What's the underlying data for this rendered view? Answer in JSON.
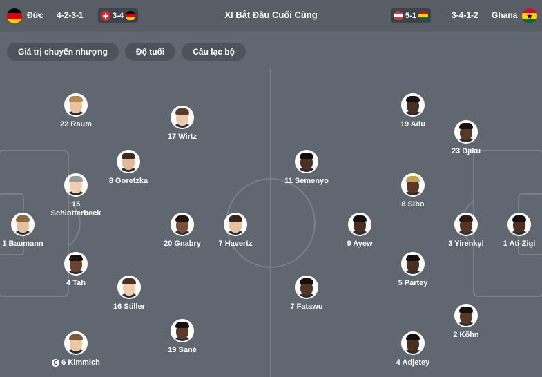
{
  "header": {
    "home": {
      "name": "Đức",
      "formation": "4-2-3-1"
    },
    "away": {
      "name": "Ghana",
      "formation": "3-4-1-2"
    },
    "title": "XI Bắt Đầu Cuối Cùng",
    "home_prev_score": "3-4",
    "away_prev_score": "5-1"
  },
  "tabs": [
    "Giá trị chuyển nhượng",
    "Độ tuổi",
    "Câu lạc bộ"
  ],
  "colors": {
    "header_bg": "#585d66",
    "pitch_bg": "#616770",
    "pitch_lines": "#7a7f88"
  },
  "home_players": [
    {
      "number": "22",
      "name": "Raum",
      "skin": "#e8c2a0",
      "hair": "#b08850"
    },
    {
      "number": "17",
      "name": "Wirtz",
      "skin": "#eec8a8",
      "hair": "#5a3a28"
    },
    {
      "number": "8",
      "name": "Goretzka",
      "skin": "#e2b896",
      "hair": "#3a2a20"
    },
    {
      "number": "15",
      "name": "Schlotterbeck",
      "skin": "#f0cdb0",
      "hair": "#9a9a9a"
    },
    {
      "number": "1",
      "name": "Baumann",
      "skin": "#e6bf9c",
      "hair": "#8a6a40"
    },
    {
      "number": "20",
      "name": "Gnabry",
      "skin": "#7a5038",
      "hair": "#1e1612"
    },
    {
      "number": "7",
      "name": "Havertz",
      "skin": "#e8c2a0",
      "hair": "#3a2618"
    },
    {
      "number": "4",
      "name": "Tah",
      "skin": "#6a4430",
      "hair": "#1a1210"
    },
    {
      "number": "16",
      "name": "Stiller",
      "skin": "#f0ccac",
      "hair": "#4a3222"
    },
    {
      "number": "19",
      "name": "Sané",
      "skin": "#5c3a28",
      "hair": "#151010"
    },
    {
      "number": "6",
      "name": "Kimmich",
      "skin": "#ecc6a4",
      "hair": "#7a5a3a",
      "captain": true
    }
  ],
  "away_players": [
    {
      "number": "19",
      "name": "Adu",
      "skin": "#4a2e20",
      "hair": "#141010"
    },
    {
      "number": "23",
      "name": "Djiku",
      "skin": "#5a3826",
      "hair": "#151010"
    },
    {
      "number": "11",
      "name": "Semenyo",
      "skin": "#4e3022",
      "hair": "#141010"
    },
    {
      "number": "8",
      "name": "Sibo",
      "skin": "#5a3826",
      "hair": "#c8a050"
    },
    {
      "number": "9",
      "name": "Ayew",
      "skin": "#4a2e20",
      "hair": "#141010"
    },
    {
      "number": "3",
      "name": "Yirenkyi",
      "skin": "#553522",
      "hair": "#2a1a10"
    },
    {
      "number": "1",
      "name": "Ati-Zigi",
      "skin": "#4e3022",
      "hair": "#141010"
    },
    {
      "number": "5",
      "name": "Partey",
      "skin": "#4a2e20",
      "hair": "#141010"
    },
    {
      "number": "7",
      "name": "Fatawu",
      "skin": "#553522",
      "hair": "#141010"
    },
    {
      "number": "2",
      "name": "Kõhn",
      "skin": "#5a3826",
      "hair": "#141010"
    },
    {
      "number": "4",
      "name": "Adjetey",
      "skin": "#4a2e20",
      "hair": "#141010"
    }
  ]
}
